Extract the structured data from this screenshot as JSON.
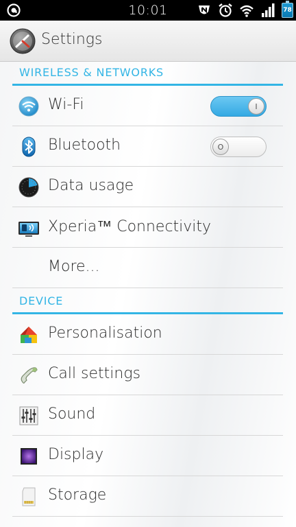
{
  "status_bar": {
    "time": "10:01",
    "battery_level": "78",
    "icons": [
      "app-notification-icon",
      "nfc-icon",
      "alarm-icon",
      "wifi-icon",
      "signal-icon",
      "battery-icon"
    ]
  },
  "action_bar": {
    "title": "Settings",
    "icon": "settings-app-icon"
  },
  "sections": {
    "wireless": {
      "header": "WIRELESS & NETWORKS",
      "items": [
        {
          "label": "Wi-Fi",
          "icon": "wifi-icon",
          "toggle": "on"
        },
        {
          "label": "Bluetooth",
          "icon": "bluetooth-icon",
          "toggle": "off"
        },
        {
          "label": "Data usage",
          "icon": "data-usage-icon"
        },
        {
          "label": "Xperia™ Connectivity",
          "icon": "xperia-connectivity-icon"
        },
        {
          "label": "More..."
        }
      ]
    },
    "device": {
      "header": "DEVICE",
      "items": [
        {
          "label": "Personalisation",
          "icon": "personalisation-icon"
        },
        {
          "label": "Call settings",
          "icon": "phone-handset-icon"
        },
        {
          "label": "Sound",
          "icon": "equalizer-icon"
        },
        {
          "label": "Display",
          "icon": "display-icon"
        },
        {
          "label": "Storage",
          "icon": "sd-card-icon"
        }
      ]
    }
  },
  "colors": {
    "accent": "#33b5e5",
    "status_bar": "#000000"
  }
}
